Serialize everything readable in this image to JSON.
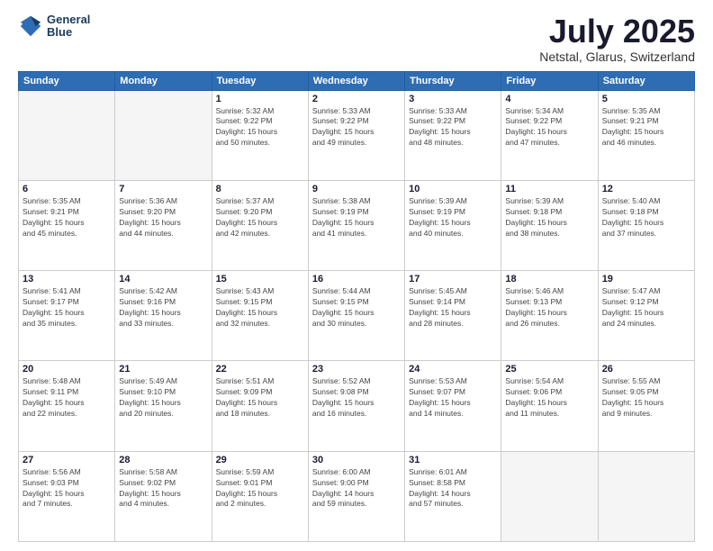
{
  "header": {
    "logo": {
      "line1": "General",
      "line2": "Blue"
    },
    "title": "July 2025",
    "subtitle": "Netstal, Glarus, Switzerland"
  },
  "calendar": {
    "days_of_week": [
      "Sunday",
      "Monday",
      "Tuesday",
      "Wednesday",
      "Thursday",
      "Friday",
      "Saturday"
    ],
    "weeks": [
      [
        {
          "day": "",
          "info": ""
        },
        {
          "day": "",
          "info": ""
        },
        {
          "day": "1",
          "info": "Sunrise: 5:32 AM\nSunset: 9:22 PM\nDaylight: 15 hours\nand 50 minutes."
        },
        {
          "day": "2",
          "info": "Sunrise: 5:33 AM\nSunset: 9:22 PM\nDaylight: 15 hours\nand 49 minutes."
        },
        {
          "day": "3",
          "info": "Sunrise: 5:33 AM\nSunset: 9:22 PM\nDaylight: 15 hours\nand 48 minutes."
        },
        {
          "day": "4",
          "info": "Sunrise: 5:34 AM\nSunset: 9:22 PM\nDaylight: 15 hours\nand 47 minutes."
        },
        {
          "day": "5",
          "info": "Sunrise: 5:35 AM\nSunset: 9:21 PM\nDaylight: 15 hours\nand 46 minutes."
        }
      ],
      [
        {
          "day": "6",
          "info": "Sunrise: 5:35 AM\nSunset: 9:21 PM\nDaylight: 15 hours\nand 45 minutes."
        },
        {
          "day": "7",
          "info": "Sunrise: 5:36 AM\nSunset: 9:20 PM\nDaylight: 15 hours\nand 44 minutes."
        },
        {
          "day": "8",
          "info": "Sunrise: 5:37 AM\nSunset: 9:20 PM\nDaylight: 15 hours\nand 42 minutes."
        },
        {
          "day": "9",
          "info": "Sunrise: 5:38 AM\nSunset: 9:19 PM\nDaylight: 15 hours\nand 41 minutes."
        },
        {
          "day": "10",
          "info": "Sunrise: 5:39 AM\nSunset: 9:19 PM\nDaylight: 15 hours\nand 40 minutes."
        },
        {
          "day": "11",
          "info": "Sunrise: 5:39 AM\nSunset: 9:18 PM\nDaylight: 15 hours\nand 38 minutes."
        },
        {
          "day": "12",
          "info": "Sunrise: 5:40 AM\nSunset: 9:18 PM\nDaylight: 15 hours\nand 37 minutes."
        }
      ],
      [
        {
          "day": "13",
          "info": "Sunrise: 5:41 AM\nSunset: 9:17 PM\nDaylight: 15 hours\nand 35 minutes."
        },
        {
          "day": "14",
          "info": "Sunrise: 5:42 AM\nSunset: 9:16 PM\nDaylight: 15 hours\nand 33 minutes."
        },
        {
          "day": "15",
          "info": "Sunrise: 5:43 AM\nSunset: 9:15 PM\nDaylight: 15 hours\nand 32 minutes."
        },
        {
          "day": "16",
          "info": "Sunrise: 5:44 AM\nSunset: 9:15 PM\nDaylight: 15 hours\nand 30 minutes."
        },
        {
          "day": "17",
          "info": "Sunrise: 5:45 AM\nSunset: 9:14 PM\nDaylight: 15 hours\nand 28 minutes."
        },
        {
          "day": "18",
          "info": "Sunrise: 5:46 AM\nSunset: 9:13 PM\nDaylight: 15 hours\nand 26 minutes."
        },
        {
          "day": "19",
          "info": "Sunrise: 5:47 AM\nSunset: 9:12 PM\nDaylight: 15 hours\nand 24 minutes."
        }
      ],
      [
        {
          "day": "20",
          "info": "Sunrise: 5:48 AM\nSunset: 9:11 PM\nDaylight: 15 hours\nand 22 minutes."
        },
        {
          "day": "21",
          "info": "Sunrise: 5:49 AM\nSunset: 9:10 PM\nDaylight: 15 hours\nand 20 minutes."
        },
        {
          "day": "22",
          "info": "Sunrise: 5:51 AM\nSunset: 9:09 PM\nDaylight: 15 hours\nand 18 minutes."
        },
        {
          "day": "23",
          "info": "Sunrise: 5:52 AM\nSunset: 9:08 PM\nDaylight: 15 hours\nand 16 minutes."
        },
        {
          "day": "24",
          "info": "Sunrise: 5:53 AM\nSunset: 9:07 PM\nDaylight: 15 hours\nand 14 minutes."
        },
        {
          "day": "25",
          "info": "Sunrise: 5:54 AM\nSunset: 9:06 PM\nDaylight: 15 hours\nand 11 minutes."
        },
        {
          "day": "26",
          "info": "Sunrise: 5:55 AM\nSunset: 9:05 PM\nDaylight: 15 hours\nand 9 minutes."
        }
      ],
      [
        {
          "day": "27",
          "info": "Sunrise: 5:56 AM\nSunset: 9:03 PM\nDaylight: 15 hours\nand 7 minutes."
        },
        {
          "day": "28",
          "info": "Sunrise: 5:58 AM\nSunset: 9:02 PM\nDaylight: 15 hours\nand 4 minutes."
        },
        {
          "day": "29",
          "info": "Sunrise: 5:59 AM\nSunset: 9:01 PM\nDaylight: 15 hours\nand 2 minutes."
        },
        {
          "day": "30",
          "info": "Sunrise: 6:00 AM\nSunset: 9:00 PM\nDaylight: 14 hours\nand 59 minutes."
        },
        {
          "day": "31",
          "info": "Sunrise: 6:01 AM\nSunset: 8:58 PM\nDaylight: 14 hours\nand 57 minutes."
        },
        {
          "day": "",
          "info": ""
        },
        {
          "day": "",
          "info": ""
        }
      ]
    ]
  }
}
